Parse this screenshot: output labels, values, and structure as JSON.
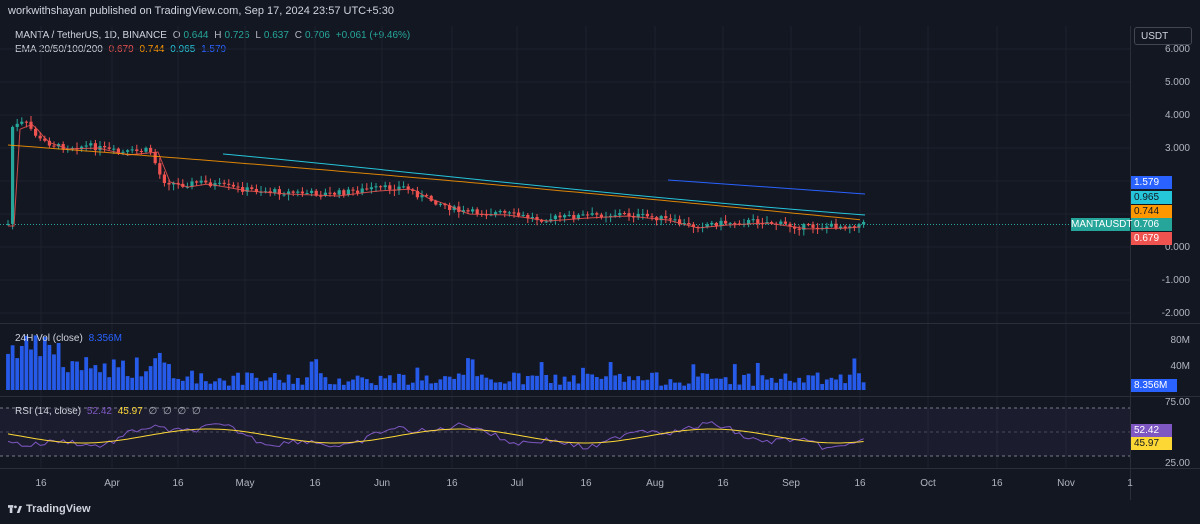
{
  "header": {
    "published_line": "workwithshayan published on TradingView.com, Sep 17, 2024 23:57 UTC+5:30"
  },
  "symbol_legend": {
    "title": "MANTA / TetherUS, 1D, BINANCE",
    "o_label": "O",
    "o_value": "0.644",
    "h_label": "H",
    "h_value": "0.726",
    "l_label": "L",
    "l_value": "0.637",
    "c_label": "C",
    "c_value": "0.706",
    "change": "+0.061 (+9.46%)"
  },
  "ema_legend": {
    "title": "EMA 20/50/100/200",
    "v20": "0.679",
    "v50": "0.744",
    "v100": "0.965",
    "v200": "1.579"
  },
  "currency_button": "USDT",
  "price_ticks": [
    "6.000",
    "5.000",
    "4.000",
    "3.000",
    "0.000",
    "-1.000",
    "-2.000"
  ],
  "price_tags": {
    "ema200": "1.579",
    "ema100": "0.965",
    "ema50": "0.744",
    "close": "0.706",
    "ema20": "0.679",
    "symbol": "MANTAUSDT"
  },
  "volume": {
    "title": "24H Vol (close)",
    "value": "8.356M",
    "ticks": [
      "80M",
      "40M"
    ],
    "tag": "8.356M"
  },
  "rsi": {
    "title": "RSI (14, close)",
    "rsi_value": "52.42",
    "ma_value": "45.97",
    "extras": [
      "∅",
      "∅",
      "∅",
      "∅"
    ],
    "ticks": [
      "75.00",
      "25.00"
    ],
    "tag_rsi": "52.42",
    "tag_ma": "45.97"
  },
  "x_axis": [
    "16",
    "Apr",
    "16",
    "May",
    "16",
    "Jun",
    "16",
    "Jul",
    "16",
    "Aug",
    "16",
    "Sep",
    "16",
    "Oct",
    "16",
    "Nov",
    "1"
  ],
  "footer": {
    "brand": "TradingView"
  },
  "colors": {
    "bg": "#131722",
    "up": "#26a69a",
    "down": "#ef5350",
    "ema20": "#ef5350",
    "ema50": "#ff9800",
    "ema100": "#26c6da",
    "ema200": "#2962ff",
    "volume": "#2962ff",
    "rsi": "#7e57c2",
    "rsi_ma": "#fdd835"
  }
}
